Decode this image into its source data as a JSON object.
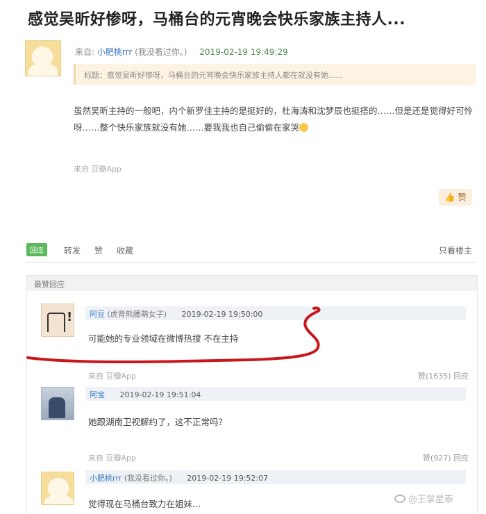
{
  "page": {
    "title": "感觉吴昕好惨呀，马桶台的元宵晚会快乐家族主持人..."
  },
  "post": {
    "from_label": "来自:",
    "user": "小肥桃rrr",
    "user_note": "(我没看过你。)",
    "time": "2019-02-19 19:49:29",
    "quote": "标题：感觉吴昕好惨呀，马桶台的元宵晚会快乐家族主持人都在就没有她......",
    "body": "虽然吴昕主持的一般吧，内个新罗佳主持的是挺好的，杜海涛和沈梦辰也挺搭的……但是还是觉得好可怜呀……整个快乐家族就没有她……要我我也自己偷偷在家哭",
    "source": "来自 豆瓣App",
    "like_label": "赞"
  },
  "actions": {
    "reply_tag": "回应",
    "items": [
      "转发",
      "赞",
      "收藏"
    ],
    "right": "只看楼主"
  },
  "comments": {
    "header": "最赞回应",
    "list": [
      {
        "user": "阿豆",
        "user_note": "(虎背熊腰萌女子)",
        "time": "2019-02-19 19:50:00",
        "text": "可能她的专业领域在微博热搜 不在主持",
        "source": "来自 豆瓣App",
        "stats": "赞(1635)  回应"
      },
      {
        "user": "阿宝",
        "user_note": "",
        "time": "2019-02-19 19:51:04",
        "text": "她跟湖南卫视解约了，这不正常吗？",
        "source": "来自 豆瓣App",
        "stats": "赞(927)  回应"
      },
      {
        "user": "小肥桃rrr",
        "user_note": "(我没看过你。)",
        "time": "2019-02-19 19:52:07",
        "text": "觉得现在马桶台致力在姐妹...",
        "source": "",
        "stats": ""
      }
    ]
  },
  "watermark": "@王掌星泰",
  "colors": {
    "annotation": "#c8181c",
    "link": "#3a78c4",
    "reply_tag": "#5cb85c"
  }
}
